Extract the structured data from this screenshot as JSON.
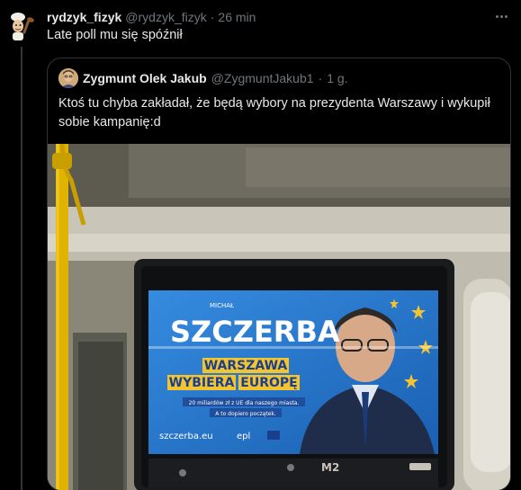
{
  "tweet": {
    "author_name": "rydzyk_fizyk",
    "author_handle": "@rydzyk_fizyk",
    "separator": "·",
    "time": "26 min",
    "text": "Late poll mu się spóźnił"
  },
  "quoted": {
    "author_name": "Zygmunt Olek Jakub",
    "author_handle": "@ZygmuntJakub1",
    "separator": "·",
    "time": "1 g.",
    "text": "Ktoś tu chyba zakładał, że będą wybory na prezydenta Warszawy i wykupił sobie kampanię:d"
  },
  "poster": {
    "first_name": "MICHAŁ",
    "last_name": "SZCZERBA",
    "slogan_line1": "WARSZAWA",
    "slogan_line2": "WYBIERA",
    "slogan_line3": "EUROPĘ",
    "claim_line1": "20 miliardów zł z UE dla naszego miasta.",
    "claim_line2": "A to dopiero początek.",
    "website": "szczerba.eu",
    "party_logo": "epl",
    "door_label": "M2"
  },
  "icons": {
    "avatar": "chef-cartoon-icon",
    "more": "more-horizontal-icon"
  },
  "colors": {
    "background": "#000000",
    "text_primary": "#e7e9ea",
    "text_secondary": "#71767b",
    "border": "#2f3336",
    "poster_blue": "#2a7fd4",
    "eu_star": "#f4c430",
    "handrail": "#e0b300"
  }
}
